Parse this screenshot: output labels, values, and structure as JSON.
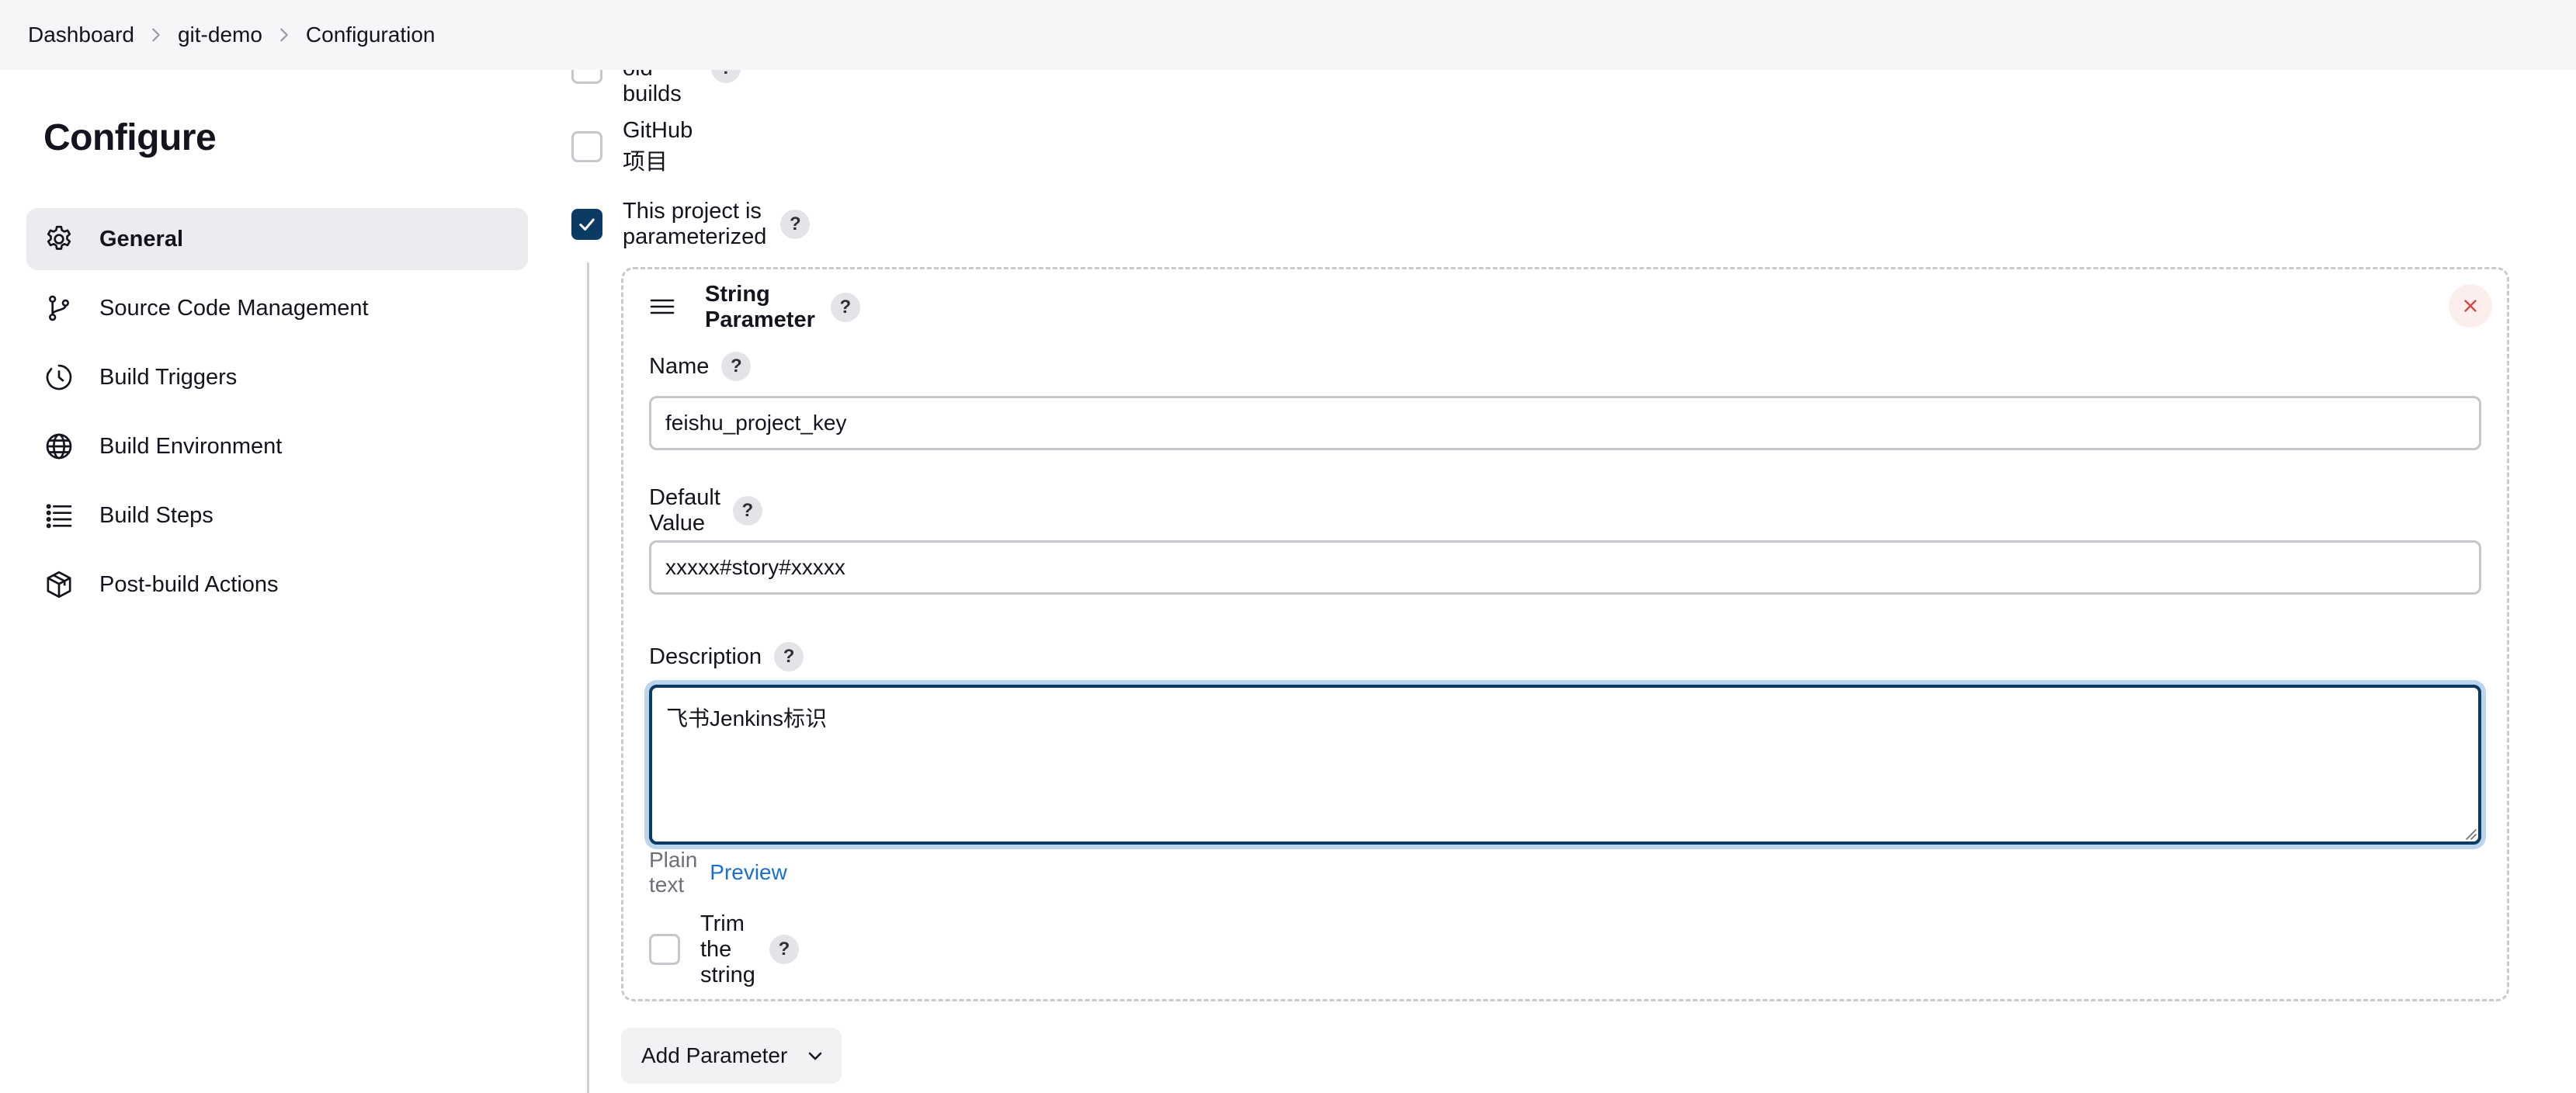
{
  "breadcrumb": [
    "Dashboard",
    "git-demo",
    "Configuration"
  ],
  "page_title": "Configure",
  "sidebar": {
    "items": [
      {
        "label": "General",
        "icon": "gear-icon",
        "active": true
      },
      {
        "label": "Source Code Management",
        "icon": "branch-icon",
        "active": false
      },
      {
        "label": "Build Triggers",
        "icon": "clock-icon",
        "active": false
      },
      {
        "label": "Build Environment",
        "icon": "globe-icon",
        "active": false
      },
      {
        "label": "Build Steps",
        "icon": "list-icon",
        "active": false
      },
      {
        "label": "Post-build Actions",
        "icon": "package-icon",
        "active": false
      }
    ]
  },
  "options": {
    "discard_old_builds": {
      "label": "Discard old builds",
      "checked": false
    },
    "github_project": {
      "label": "GitHub 项目",
      "checked": false
    },
    "parameterized": {
      "label": "This project is parameterized",
      "checked": true
    }
  },
  "string_parameter": {
    "title": "String Parameter",
    "name_label": "Name",
    "name_value": "feishu_project_key",
    "default_label": "Default Value",
    "default_value": "xxxxx#story#xxxxx",
    "description_label": "Description",
    "description_value": "飞书Jenkins标识",
    "plain_text": "Plain text",
    "preview": "Preview",
    "trim_label": "Trim the string",
    "trim_checked": false
  },
  "add_parameter": "Add Parameter",
  "help_glyph": "?",
  "colors": {
    "accent": "#0b3b63",
    "link": "#1a6fcf",
    "danger": "#d24545",
    "focus_ring": "#bcd5ee"
  }
}
